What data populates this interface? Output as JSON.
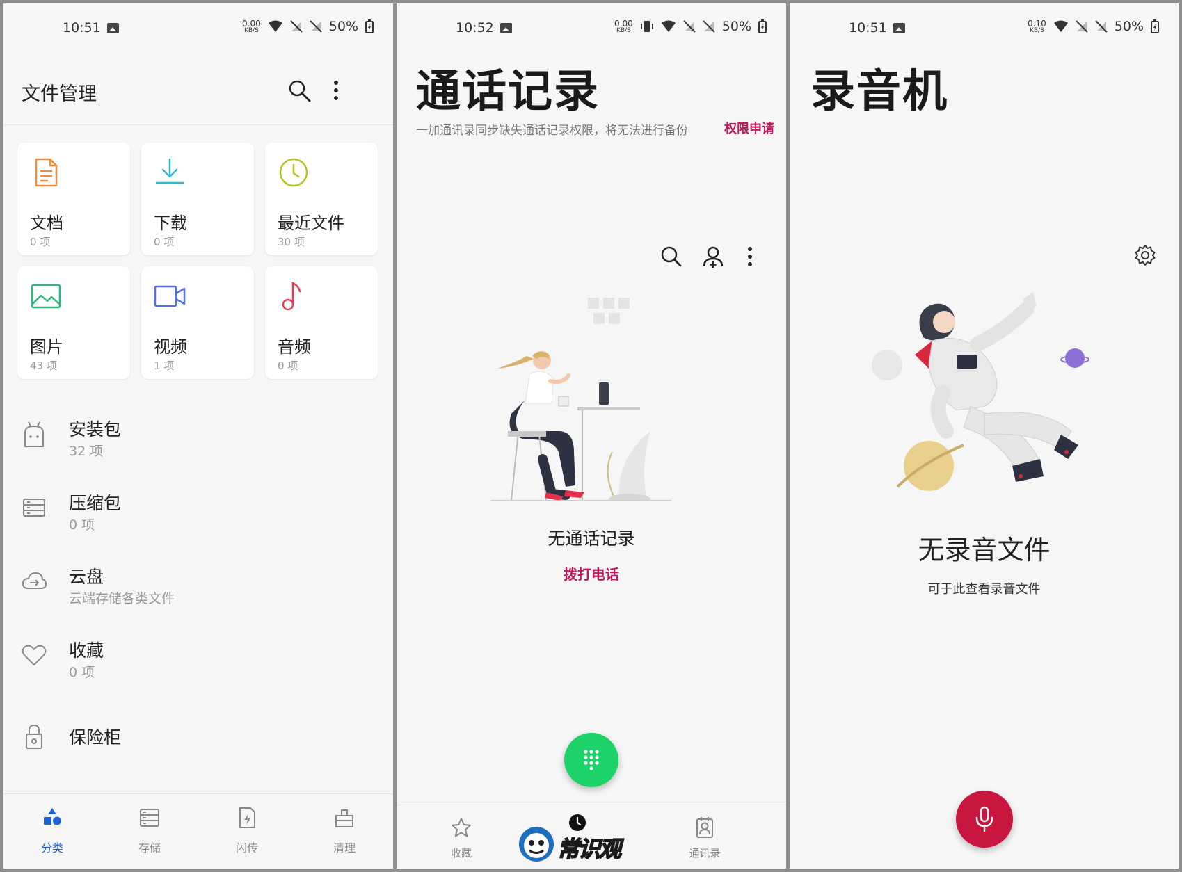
{
  "screens": {
    "file_manager": {
      "status": {
        "time": "10:51",
        "speed_value": "0.00",
        "speed_unit": "KB/S",
        "battery": "50%"
      },
      "title": "文件管理",
      "tiles": [
        {
          "label": "文档",
          "count": "0 项",
          "icon": "document-icon",
          "color": "#f08a3c"
        },
        {
          "label": "下载",
          "count": "0 项",
          "icon": "download-icon",
          "color": "#35b4d8"
        },
        {
          "label": "最近文件",
          "count": "30 项",
          "icon": "clock-icon",
          "color": "#b5c620"
        },
        {
          "label": "图片",
          "count": "43 项",
          "icon": "image-icon",
          "color": "#2fb67a"
        },
        {
          "label": "视频",
          "count": "1 项",
          "icon": "video-icon",
          "color": "#5170e6"
        },
        {
          "label": "音频",
          "count": "0 项",
          "icon": "music-note-icon",
          "color": "#e23e57"
        }
      ],
      "list": [
        {
          "label": "安装包",
          "sub": "32 项",
          "icon": "android-icon"
        },
        {
          "label": "压缩包",
          "sub": "0 项",
          "icon": "archive-icon"
        },
        {
          "label": "云盘",
          "sub": "云端存储各类文件",
          "icon": "cloud-icon"
        },
        {
          "label": "收藏",
          "sub": "0 项",
          "icon": "heart-icon"
        },
        {
          "label": "保险柜",
          "sub": "",
          "icon": "lock-icon"
        }
      ],
      "bottom_nav": [
        {
          "label": "分类",
          "icon": "category-icon",
          "active": true
        },
        {
          "label": "存储",
          "icon": "storage-icon",
          "active": false
        },
        {
          "label": "闪传",
          "icon": "flash-transfer-icon",
          "active": false
        },
        {
          "label": "清理",
          "icon": "clean-icon",
          "active": false
        }
      ]
    },
    "call_log": {
      "status": {
        "time": "10:52",
        "speed_value": "0.00",
        "speed_unit": "KB/S",
        "battery": "50%"
      },
      "title": "通话记录",
      "notice": "一加通讯录同步缺失通话记录权限，将无法进行备份",
      "notice_link": "权限申请",
      "empty_title": "无通话记录",
      "empty_link": "拨打电话",
      "bottom_nav": [
        {
          "label": "收藏",
          "icon": "star-icon"
        },
        {
          "label": "通讯录",
          "icon": "contacts-icon"
        }
      ],
      "watermark": "常识观",
      "accent": "#c2185b",
      "fab_color": "#1ed26a"
    },
    "recorder": {
      "status": {
        "time": "10:51",
        "speed_value": "0.10",
        "speed_unit": "KB/S",
        "battery": "50%"
      },
      "title": "录音机",
      "empty_title": "无录音文件",
      "empty_sub": "可于此查看录音文件",
      "fab_color": "#c8163f"
    }
  }
}
